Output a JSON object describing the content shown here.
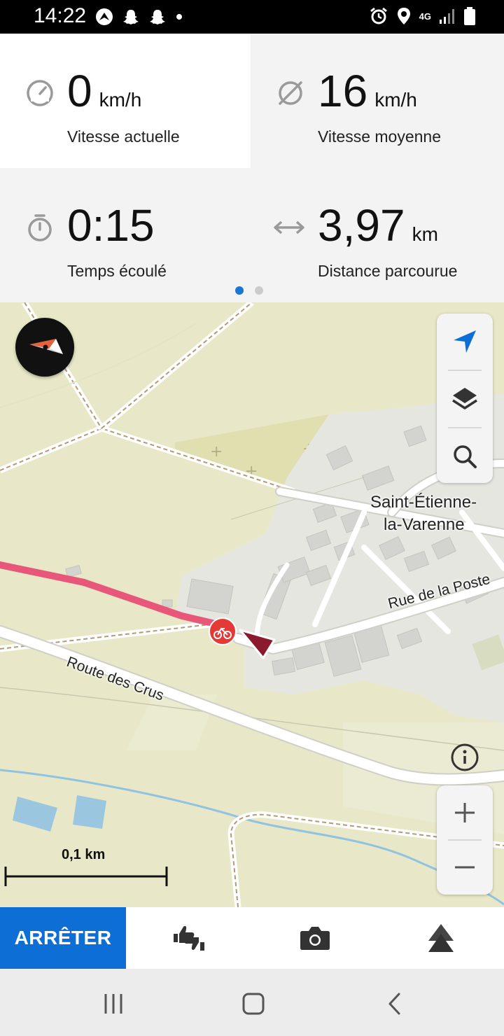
{
  "status_bar": {
    "time": "14:22",
    "network": "4G",
    "icons": [
      "navigation-app-icon",
      "snapchat-icon",
      "snapchat-icon",
      "notification-dot-icon",
      "alarm-icon",
      "location-icon",
      "signal-icon",
      "battery-icon"
    ]
  },
  "stats": {
    "current_speed": {
      "value": "0",
      "unit": "km/h",
      "label": "Vitesse actuelle",
      "icon": "speedometer-icon"
    },
    "average_speed": {
      "value": "16",
      "unit": "km/h",
      "label": "Vitesse moyenne",
      "icon": "average-icon"
    },
    "elapsed_time": {
      "value": "0:15",
      "unit": "",
      "label": "Temps écoulé",
      "icon": "stopwatch-icon"
    },
    "distance": {
      "value": "3,97",
      "unit": "km",
      "label": "Distance parcourue",
      "icon": "horizontal-arrows-icon"
    },
    "page_indicator": {
      "pages": 2,
      "active": 1
    }
  },
  "map": {
    "labels": {
      "town_line1": "Saint-Étienne-",
      "town_line2": "la-Varenne",
      "street_poste": "Rue de la Poste",
      "street_crus": "Route des Crus"
    },
    "scale": "0,1 km",
    "colors": {
      "route": "#e8577a",
      "position_marker": "#8b1a2e",
      "accent": "#0d6fd6",
      "bike_marker": "#e53935"
    }
  },
  "action_bar": {
    "stop_label": "ARRÊTER",
    "icons": [
      "thumbs-up-down-icon",
      "camera-icon",
      "triangle-stack-icon"
    ]
  },
  "nav_bar": {
    "icons": [
      "recent-apps-icon",
      "home-icon",
      "back-icon"
    ]
  }
}
